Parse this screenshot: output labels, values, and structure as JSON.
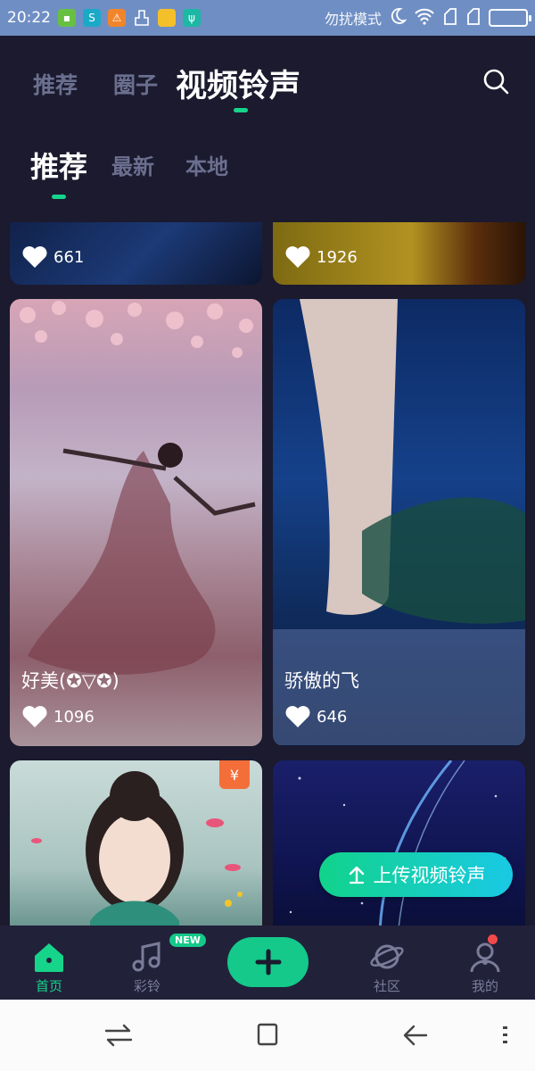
{
  "status_bar": {
    "time": "20:22",
    "dnd_text": "勿扰模式",
    "icons": [
      "app-notification-icon",
      "app-notification-icon",
      "warning-icon",
      "clean-icon",
      "folder-icon",
      "usb-icon",
      "moon-icon",
      "wifi-icon",
      "signal-icon",
      "signal-icon",
      "battery-icon"
    ]
  },
  "top_tabs": {
    "items": [
      "推荐",
      "圈子",
      "视频铃声"
    ],
    "active": "视频铃声"
  },
  "sub_tabs": {
    "items": [
      "推荐",
      "最新",
      "本地"
    ],
    "active": "推荐"
  },
  "feed": {
    "cards": [
      {
        "title": "",
        "likes": "661"
      },
      {
        "title": "",
        "likes": "1926"
      },
      {
        "title": "好美(✪▽✪)",
        "likes": "1096"
      },
      {
        "title": "骄傲的飞",
        "likes": "646"
      },
      {
        "title": "",
        "likes": "",
        "price_tag": "¥"
      },
      {
        "title": "",
        "likes": ""
      }
    ],
    "upload_label": "上传视频铃声"
  },
  "bottom_nav": {
    "items": [
      {
        "label": "首页",
        "icon": "home-icon"
      },
      {
        "label": "彩铃",
        "icon": "music-note-icon",
        "badge": "NEW"
      },
      {
        "label": "",
        "icon": "plus-icon"
      },
      {
        "label": "社区",
        "icon": "planet-icon"
      },
      {
        "label": "我的",
        "icon": "profile-icon"
      }
    ],
    "active": "首页"
  },
  "colors": {
    "accent": "#17d48b",
    "background": "#1b1a2e",
    "nav_background": "#22213a",
    "status_bar": "#6f8fc4"
  }
}
